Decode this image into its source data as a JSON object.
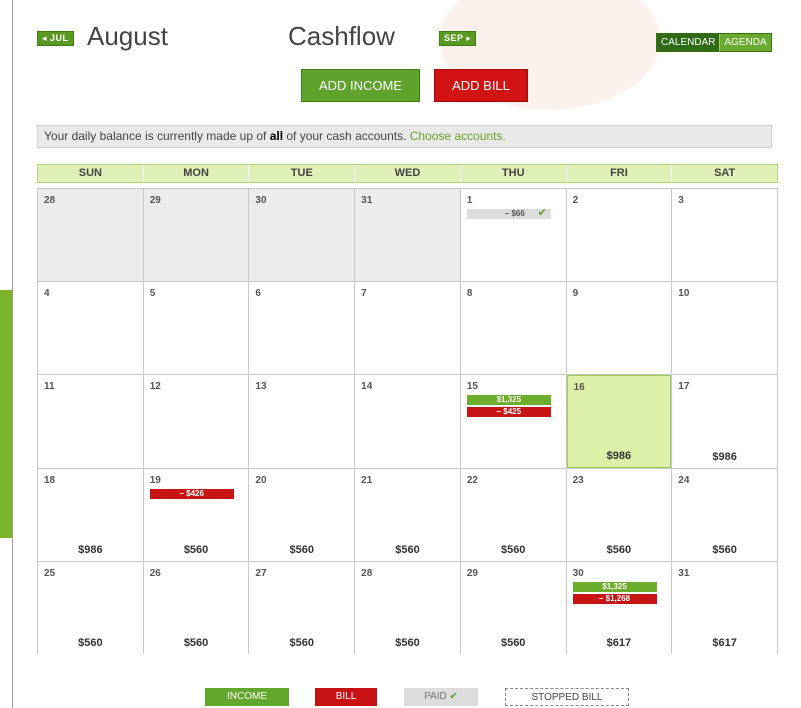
{
  "header": {
    "prev_month": "◂ JUL",
    "month_title": "August",
    "page_title": "Cashflow",
    "next_month": "SEP ▸",
    "view_calendar": "CALENDAR",
    "view_agenda": "AGENDA"
  },
  "actions": {
    "add_income": "ADD INCOME",
    "add_bill": "ADD BILL"
  },
  "notice": {
    "text_before": "Your daily balance is currently made up of ",
    "bold": "all",
    "text_after": " of your cash accounts. ",
    "link": "Choose accounts."
  },
  "weekdays": [
    "SUN",
    "MON",
    "TUE",
    "WED",
    "THU",
    "FRI",
    "SAT"
  ],
  "days": [
    {
      "day": "28",
      "other_month": true,
      "balance": "",
      "tx": []
    },
    {
      "day": "29",
      "other_month": true,
      "balance": "",
      "tx": []
    },
    {
      "day": "30",
      "other_month": true,
      "balance": "",
      "tx": []
    },
    {
      "day": "31",
      "other_month": true,
      "balance": "",
      "tx": []
    },
    {
      "day": "1",
      "balance": "",
      "tx": [
        {
          "type": "paid",
          "label": "– $66"
        }
      ]
    },
    {
      "day": "2",
      "balance": "",
      "tx": []
    },
    {
      "day": "3",
      "balance": "",
      "tx": []
    },
    {
      "day": "4",
      "balance": "",
      "tx": []
    },
    {
      "day": "5",
      "balance": "",
      "tx": []
    },
    {
      "day": "6",
      "balance": "",
      "tx": []
    },
    {
      "day": "7",
      "balance": "",
      "tx": []
    },
    {
      "day": "8",
      "balance": "",
      "tx": []
    },
    {
      "day": "9",
      "balance": "",
      "tx": []
    },
    {
      "day": "10",
      "balance": "",
      "tx": []
    },
    {
      "day": "11",
      "balance": "",
      "tx": []
    },
    {
      "day": "12",
      "balance": "",
      "tx": []
    },
    {
      "day": "13",
      "balance": "",
      "tx": []
    },
    {
      "day": "14",
      "balance": "",
      "tx": []
    },
    {
      "day": "15",
      "balance": "",
      "tx": [
        {
          "type": "income",
          "label": "$1,325"
        },
        {
          "type": "bill",
          "label": "– $425"
        }
      ]
    },
    {
      "day": "16",
      "today": true,
      "balance": "$986",
      "tx": []
    },
    {
      "day": "17",
      "balance": "$986",
      "tx": []
    },
    {
      "day": "18",
      "balance": "$986",
      "tx": []
    },
    {
      "day": "19",
      "balance": "$560",
      "tx": [
        {
          "type": "bill",
          "label": "– $426"
        }
      ]
    },
    {
      "day": "20",
      "balance": "$560",
      "tx": []
    },
    {
      "day": "21",
      "balance": "$560",
      "tx": []
    },
    {
      "day": "22",
      "balance": "$560",
      "tx": []
    },
    {
      "day": "23",
      "balance": "$560",
      "tx": []
    },
    {
      "day": "24",
      "balance": "$560",
      "tx": []
    },
    {
      "day": "25",
      "balance": "$560",
      "tx": []
    },
    {
      "day": "26",
      "balance": "$560",
      "tx": []
    },
    {
      "day": "27",
      "balance": "$560",
      "tx": []
    },
    {
      "day": "28",
      "balance": "$560",
      "tx": []
    },
    {
      "day": "29",
      "balance": "$560",
      "tx": []
    },
    {
      "day": "30",
      "balance": "$617",
      "tx": [
        {
          "type": "income",
          "label": "$1,325"
        },
        {
          "type": "bill",
          "label": "– $1,268"
        }
      ]
    },
    {
      "day": "31",
      "balance": "$617",
      "tx": []
    }
  ],
  "legend": {
    "income": "INCOME",
    "bill": "BILL",
    "paid": "PAID",
    "stopped": "STOPPED BILL"
  },
  "colors": {
    "income": "#63a82c",
    "bill": "#c61212",
    "today": "#dcf0a8",
    "header_row": "#dff0b8"
  }
}
